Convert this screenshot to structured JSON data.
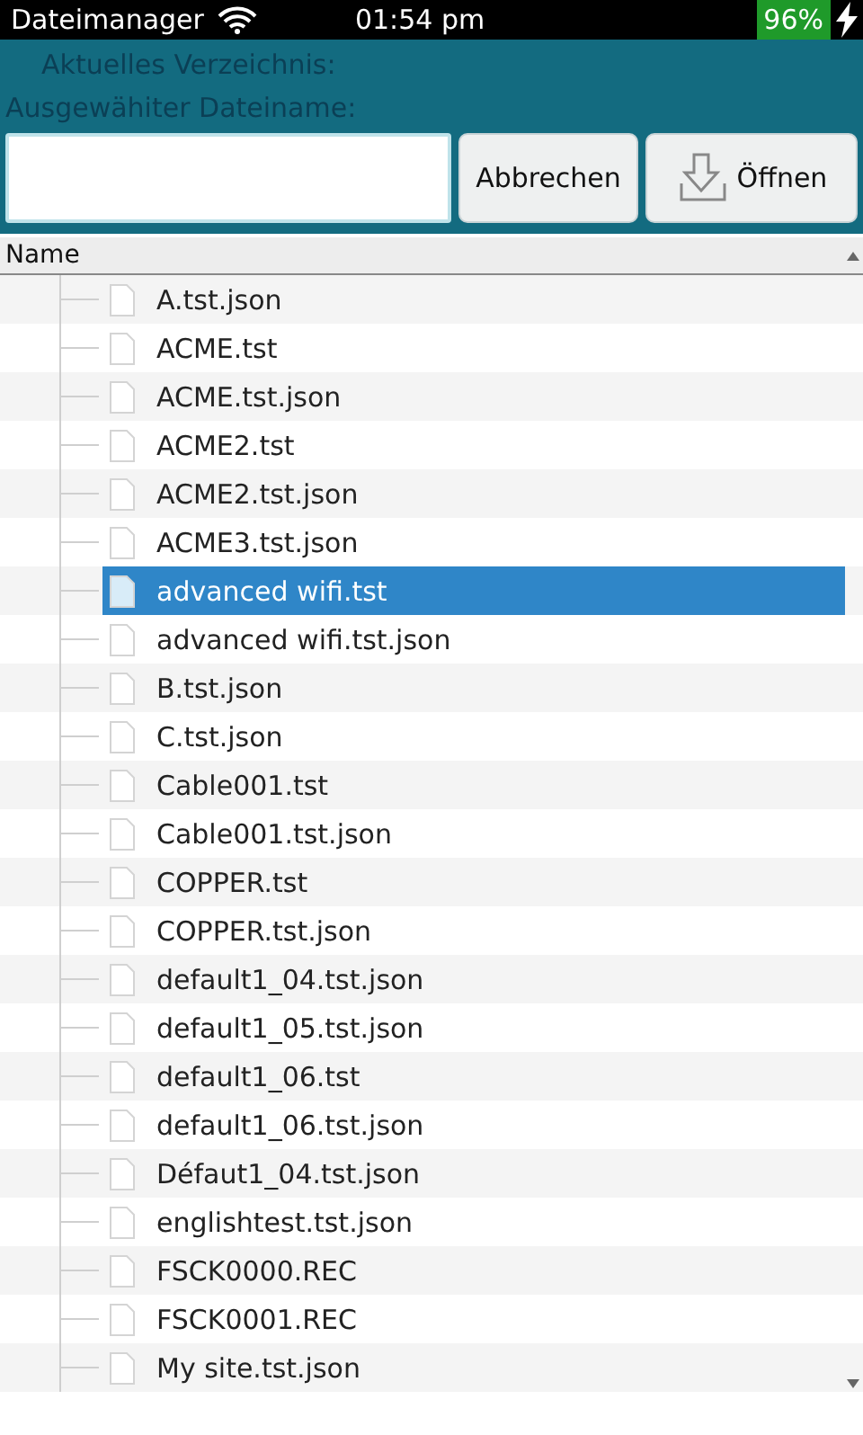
{
  "status_bar": {
    "app_name": "Dateimanager",
    "time": "01:54 pm",
    "battery": "96%"
  },
  "dialog": {
    "current_directory_label": "Aktuelles Verzeichnis:",
    "selected_filename_label": "Ausgewähiter Dateiname:",
    "buttons": [
      {
        "label": "Abbrechen",
        "kind": "text"
      },
      {
        "label": "Öffnen",
        "kind": "icon"
      }
    ]
  },
  "file_list": {
    "columns": [
      "Name"
    ],
    "rows": [
      {
        "name": "A.tst.json",
        "selected": false
      },
      {
        "name": "ACME.tst",
        "selected": false
      },
      {
        "name": "ACME.tst.json",
        "selected": false
      },
      {
        "name": "ACME2.tst",
        "selected": false
      },
      {
        "name": "ACME2.tst.json",
        "selected": false
      },
      {
        "name": "ACME3.tst.json",
        "selected": false
      },
      {
        "name": "advanced wifi.tst",
        "selected": true
      },
      {
        "name": "advanced wifi.tst.json",
        "selected": false
      },
      {
        "name": "B.tst.json",
        "selected": false
      },
      {
        "name": "C.tst.json",
        "selected": false
      },
      {
        "name": "Cable001.tst",
        "selected": false
      },
      {
        "name": "Cable001.tst.json",
        "selected": false
      },
      {
        "name": "COPPER.tst",
        "selected": false
      },
      {
        "name": "COPPER.tst.json",
        "selected": false
      },
      {
        "name": "default1_04.tst.json",
        "selected": false
      },
      {
        "name": "default1_05.tst.json",
        "selected": false
      },
      {
        "name": "default1_06.tst",
        "selected": false
      },
      {
        "name": "default1_06.tst.json",
        "selected": false
      },
      {
        "name": "Défaut1_04.tst.json",
        "selected": false
      },
      {
        "name": "englishtest.tst.json",
        "selected": false
      },
      {
        "name": "FSCK0000.REC",
        "selected": false
      },
      {
        "name": "FSCK0001.REC",
        "selected": false
      },
      {
        "name": "My site.tst.json",
        "selected": false
      }
    ]
  }
}
